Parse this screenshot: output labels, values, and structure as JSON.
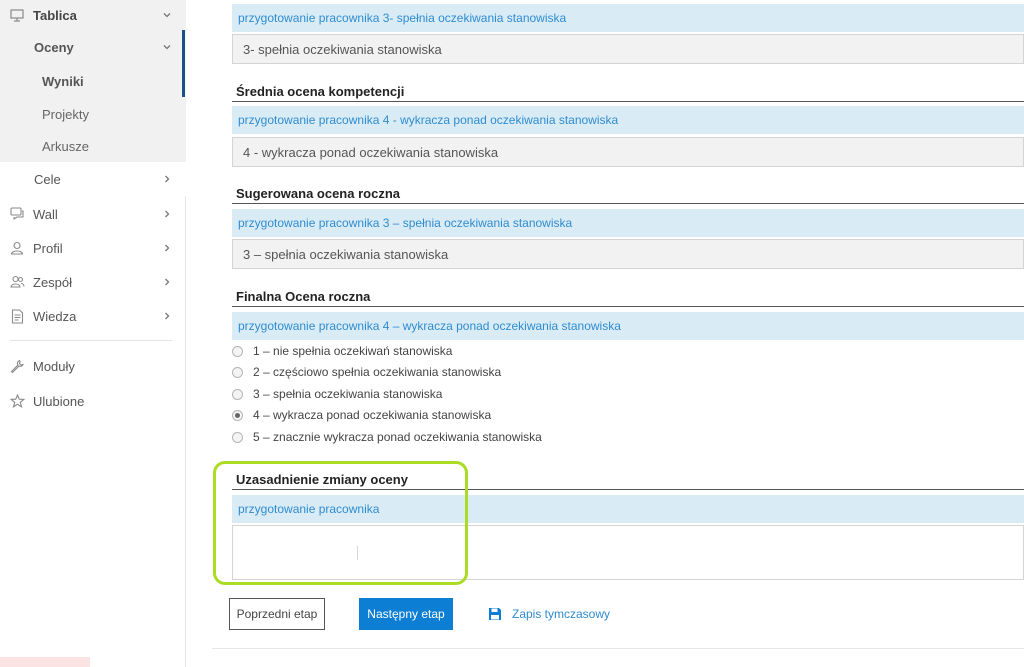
{
  "sidebar": {
    "items": [
      {
        "label": "Tablica",
        "icon": "monitor-icon"
      },
      {
        "label": "Oceny"
      },
      {
        "label": "Wyniki"
      },
      {
        "label": "Projekty"
      },
      {
        "label": "Arkusze"
      },
      {
        "label": "Cele"
      },
      {
        "label": "Wall",
        "icon": "chat-icon"
      },
      {
        "label": "Profil",
        "icon": "user-icon"
      },
      {
        "label": "Zespół",
        "icon": "team-icon"
      },
      {
        "label": "Wiedza",
        "icon": "document-icon"
      },
      {
        "label": "Moduły",
        "icon": "wrench-icon"
      },
      {
        "label": "Ulubione",
        "icon": "star-icon"
      }
    ],
    "active_color": "#1a4f8c"
  },
  "sections": {
    "top": {
      "bar": "przygotowanie pracownika 3- spełnia oczekiwania stanowiska",
      "value": "3- spełnia oczekiwania stanowiska"
    },
    "srednia": {
      "title": "Średnia ocena kompetencji",
      "bar": "przygotowanie pracownika 4 - wykracza ponad oczekiwania stanowiska",
      "value": "4 - wykracza ponad oczekiwania stanowiska"
    },
    "sugerowana": {
      "title": "Sugerowana ocena roczna",
      "bar": "przygotowanie pracownika 3 – spełnia oczekiwania stanowiska",
      "value": "3 – spełnia oczekiwania stanowiska"
    },
    "finalna": {
      "title": "Finalna Ocena roczna",
      "bar": "przygotowanie pracownika 4 – wykracza ponad oczekiwania stanowiska",
      "options": [
        "1 – nie spełnia oczekiwań stanowiska",
        "2 – częściowo spełnia oczekiwania stanowiska",
        "3 – spełnia oczekiwania stanowiska",
        "4 – wykracza ponad oczekiwania stanowiska",
        "5 – znacznie wykracza ponad oczekiwania stanowiska"
      ],
      "selected": "4 – wykracza ponad oczekiwania stanowiska"
    },
    "uzasadnienie": {
      "title": "Uzasadnienie zmiany oceny",
      "bar": "przygotowanie pracownika",
      "text": ""
    }
  },
  "actions": {
    "prev": "Poprzedni etap",
    "next": "Następny etap",
    "save": "Zapis tymczasowy"
  },
  "colors": {
    "accent_blue": "#0c7ed4",
    "bar_bg": "#d9ecf6",
    "bar_text": "#2f8bd0",
    "highlight": "#a9dc22"
  }
}
